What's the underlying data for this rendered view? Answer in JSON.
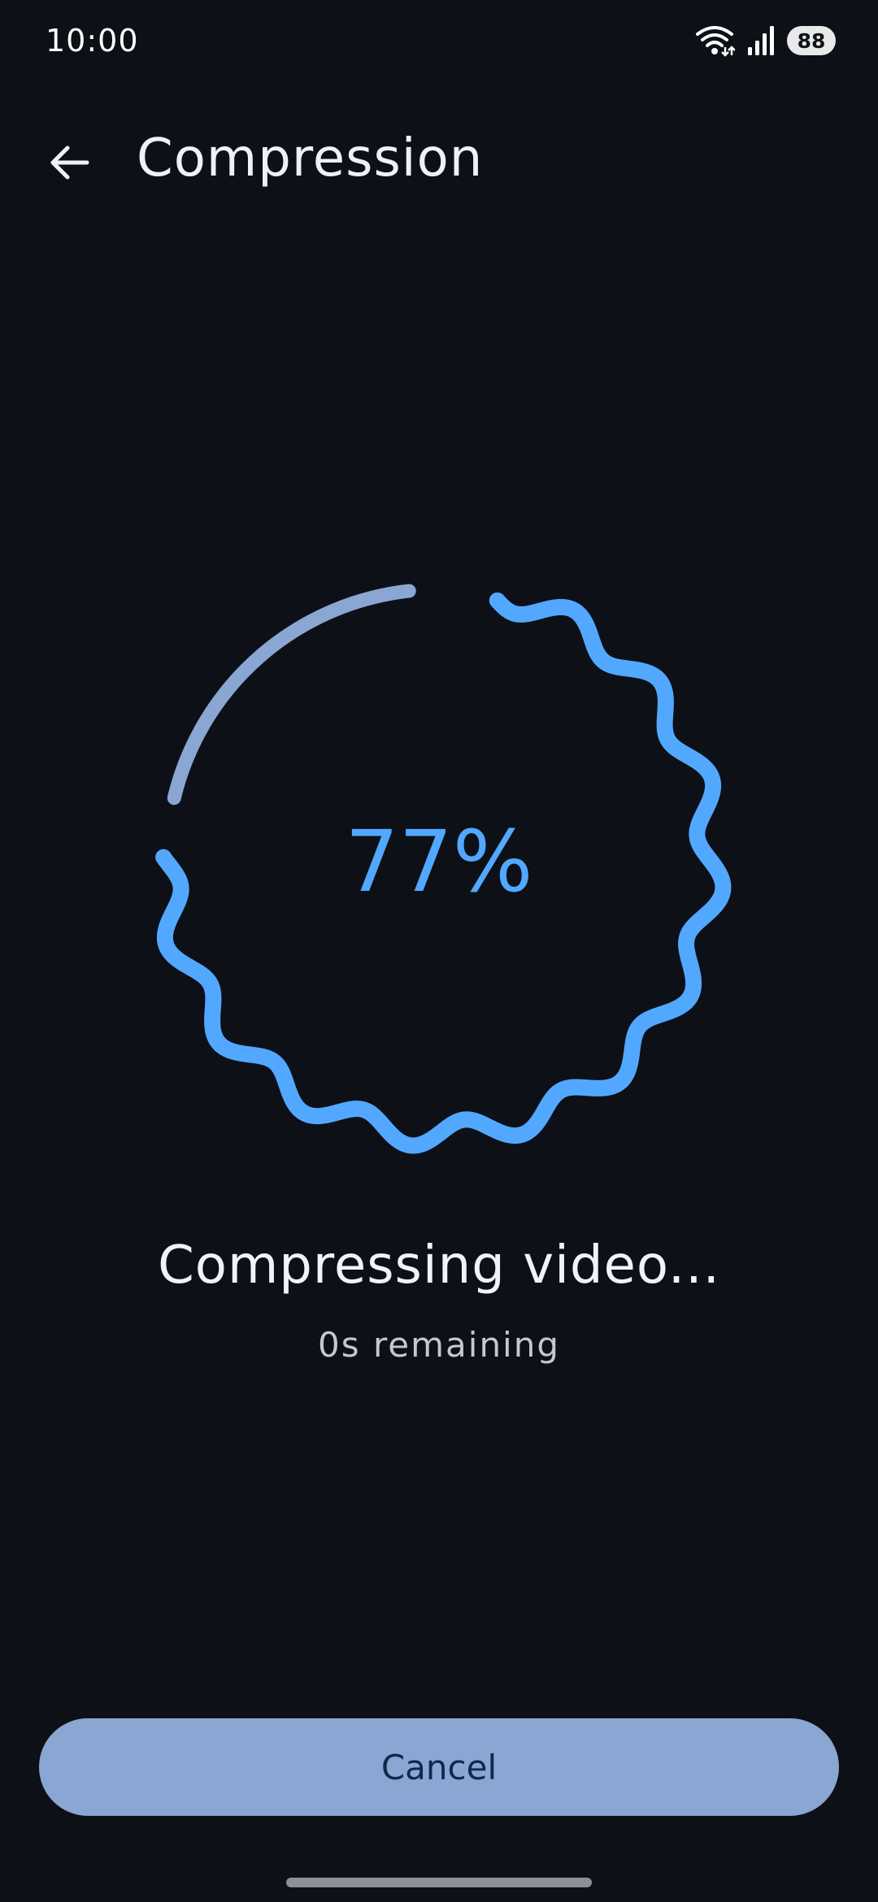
{
  "status_bar": {
    "time": "10:00",
    "battery_level": "88",
    "icons": [
      "wifi-icon",
      "signal-icon",
      "battery-icon"
    ]
  },
  "app_bar": {
    "title": "Compression",
    "back_icon": "arrow-left-icon"
  },
  "progress": {
    "percent": 77,
    "label": "77%",
    "colors": {
      "active": "#52a8ff",
      "track": "#8aa6d2"
    }
  },
  "status": {
    "title": "Compressing video...",
    "subtitle": "0s remaining"
  },
  "actions": {
    "cancel_label": "Cancel"
  },
  "colors": {
    "background": "#0d1017",
    "button_background": "#8aa6d2",
    "button_text": "#10294b"
  }
}
